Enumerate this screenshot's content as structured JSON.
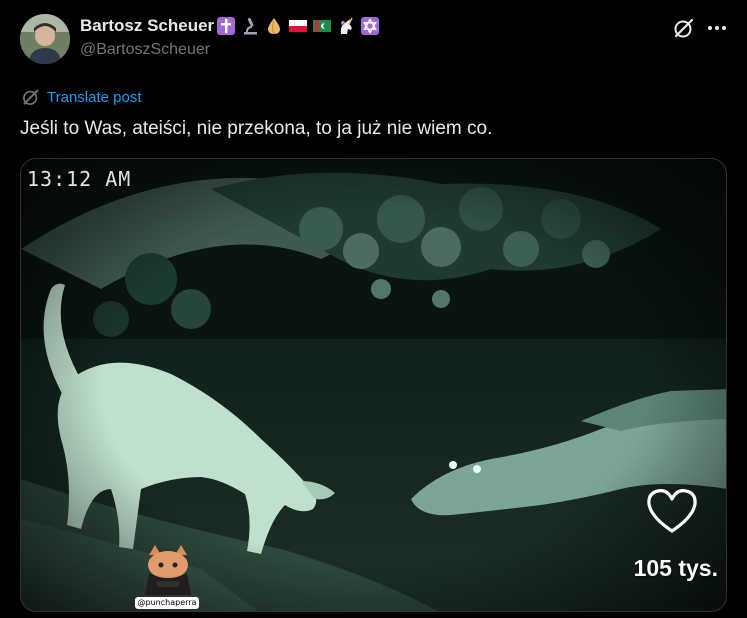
{
  "author": {
    "display_name": "Bartosz Scheuer",
    "handle": "@BartoszScheuer",
    "emoji_icons": [
      "latin-cross-icon",
      "microscope-icon",
      "onion-icon",
      "poland-flag-icon",
      "turkmenistan-flag-icon",
      "unicorn-icon",
      "star-of-david-icon"
    ]
  },
  "actions": {
    "translate_label": "Translate post"
  },
  "post": {
    "text": "Jeśli to Was, ateiści, nie przekona, to ja już nie wiem co."
  },
  "media": {
    "timestamp": "13:12 AM",
    "watermark_label": "@punchaperra",
    "like_count": "105 tys."
  },
  "colors": {
    "background": "#000000",
    "text": "#e7e9ea",
    "secondary_text": "#71767b",
    "link": "#1d9bf0"
  }
}
